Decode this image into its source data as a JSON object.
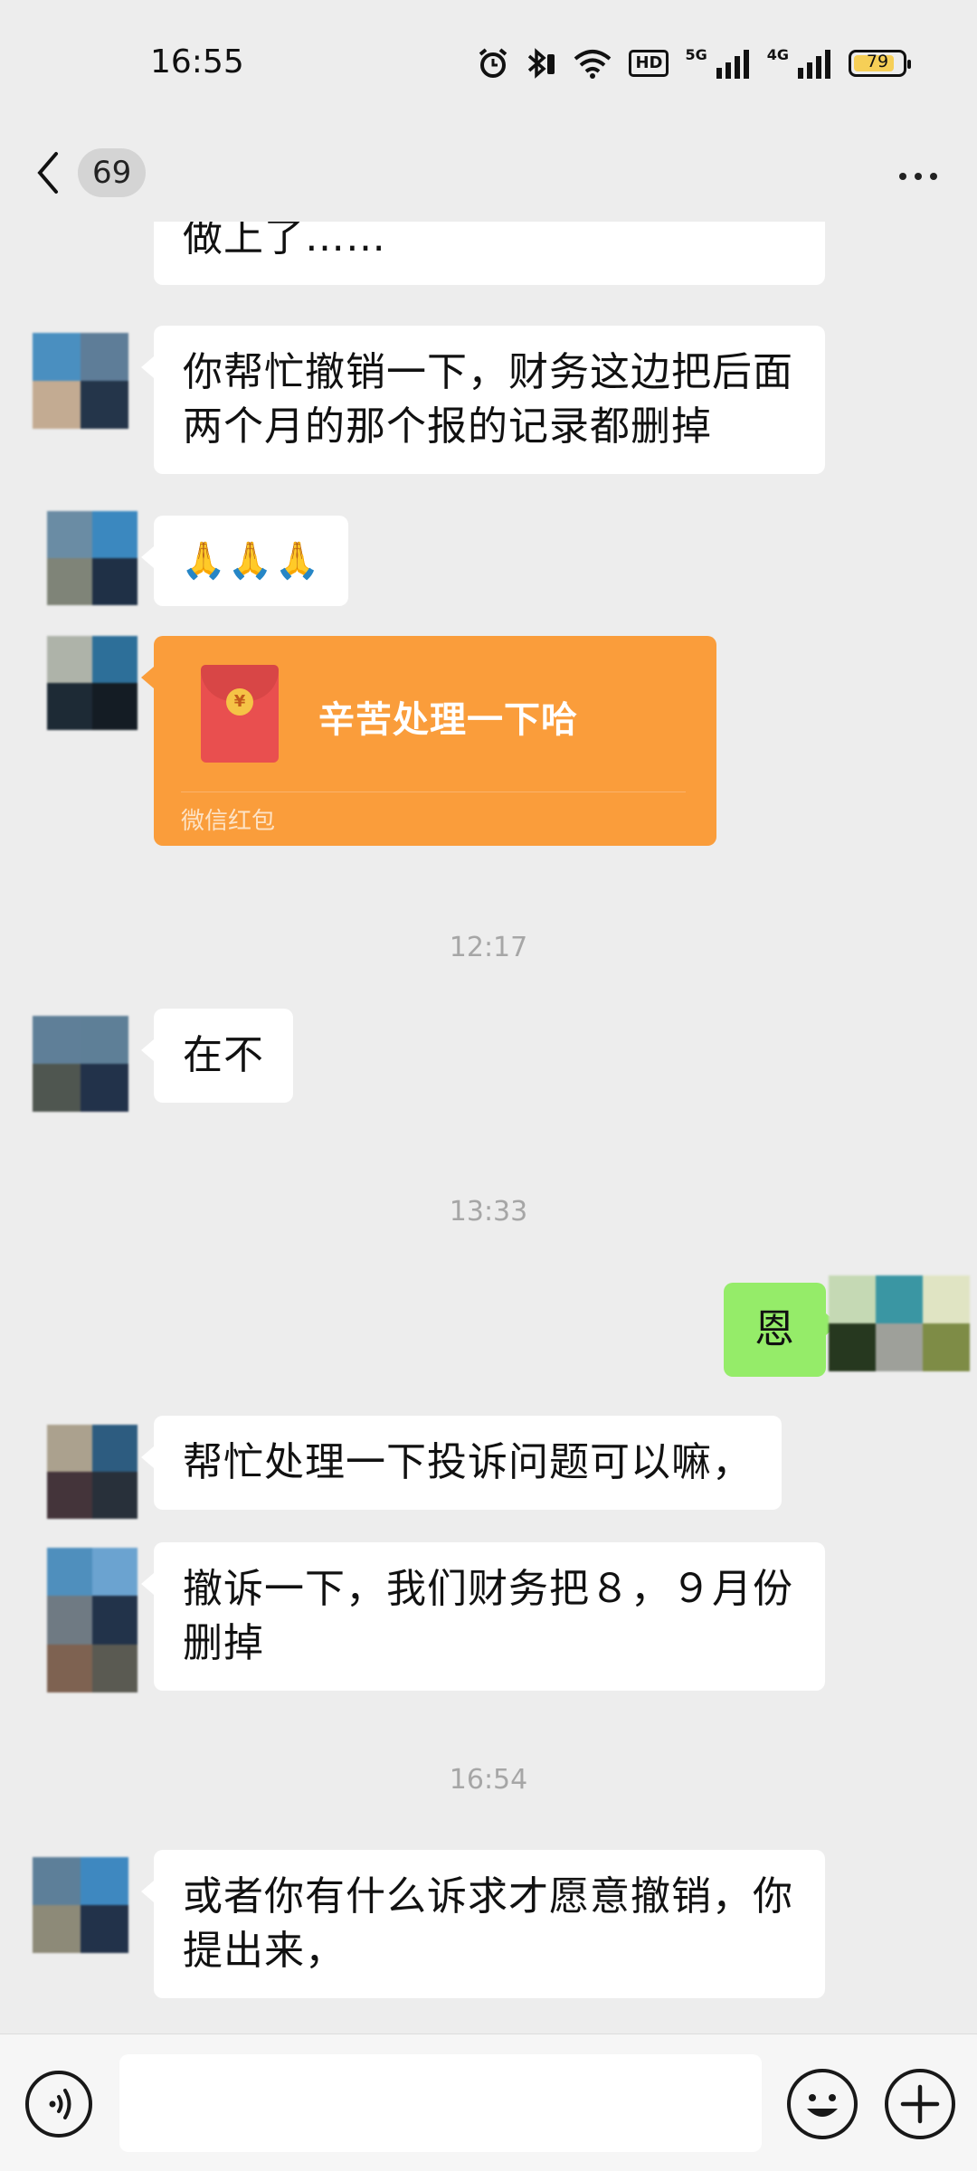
{
  "status_bar": {
    "time": "16:55",
    "hd_label": "HD",
    "net1_label": "5G",
    "net2_label": "4G",
    "battery": "79",
    "battery_color": "#f6cf57"
  },
  "nav": {
    "unread_count": "69",
    "back_icon": "chevron-left-icon",
    "more_icon": "more-dots-icon"
  },
  "messages": [
    {
      "side": "left",
      "text": "你闹软了，所以他做账的时候把你做上了……"
    },
    {
      "side": "left",
      "text": "你帮忙撤销一下，财务这边把后面两个月的那个报的记录都删掉"
    },
    {
      "side": "left",
      "text": "🙏🙏🙏"
    },
    {
      "side": "left",
      "type": "red_packet",
      "text": "辛苦处理一下哈",
      "label": "微信红包",
      "coin": "¥"
    },
    {
      "type": "time",
      "text": "12:17"
    },
    {
      "side": "left",
      "text": "在不"
    },
    {
      "type": "time",
      "text": "13:33"
    },
    {
      "side": "right",
      "text": "恩"
    },
    {
      "side": "left",
      "text": "帮忙处理一下投诉问题可以嘛，"
    },
    {
      "side": "left",
      "text": "撤诉一下，我们财务把８，９月份删掉"
    },
    {
      "type": "time",
      "text": "16:54"
    },
    {
      "side": "left",
      "text": "或者你有什么诉求才愿意撤销，你提出来，"
    }
  ],
  "input_bar": {
    "voice_icon": "voice-icon",
    "emoji_icon": "smiley-icon",
    "plus_icon": "plus-icon",
    "placeholder": ""
  },
  "colors": {
    "background": "#ededed",
    "bubble_left": "#ffffff",
    "bubble_right": "#95ec69",
    "red_packet": "#fa9d3b"
  }
}
